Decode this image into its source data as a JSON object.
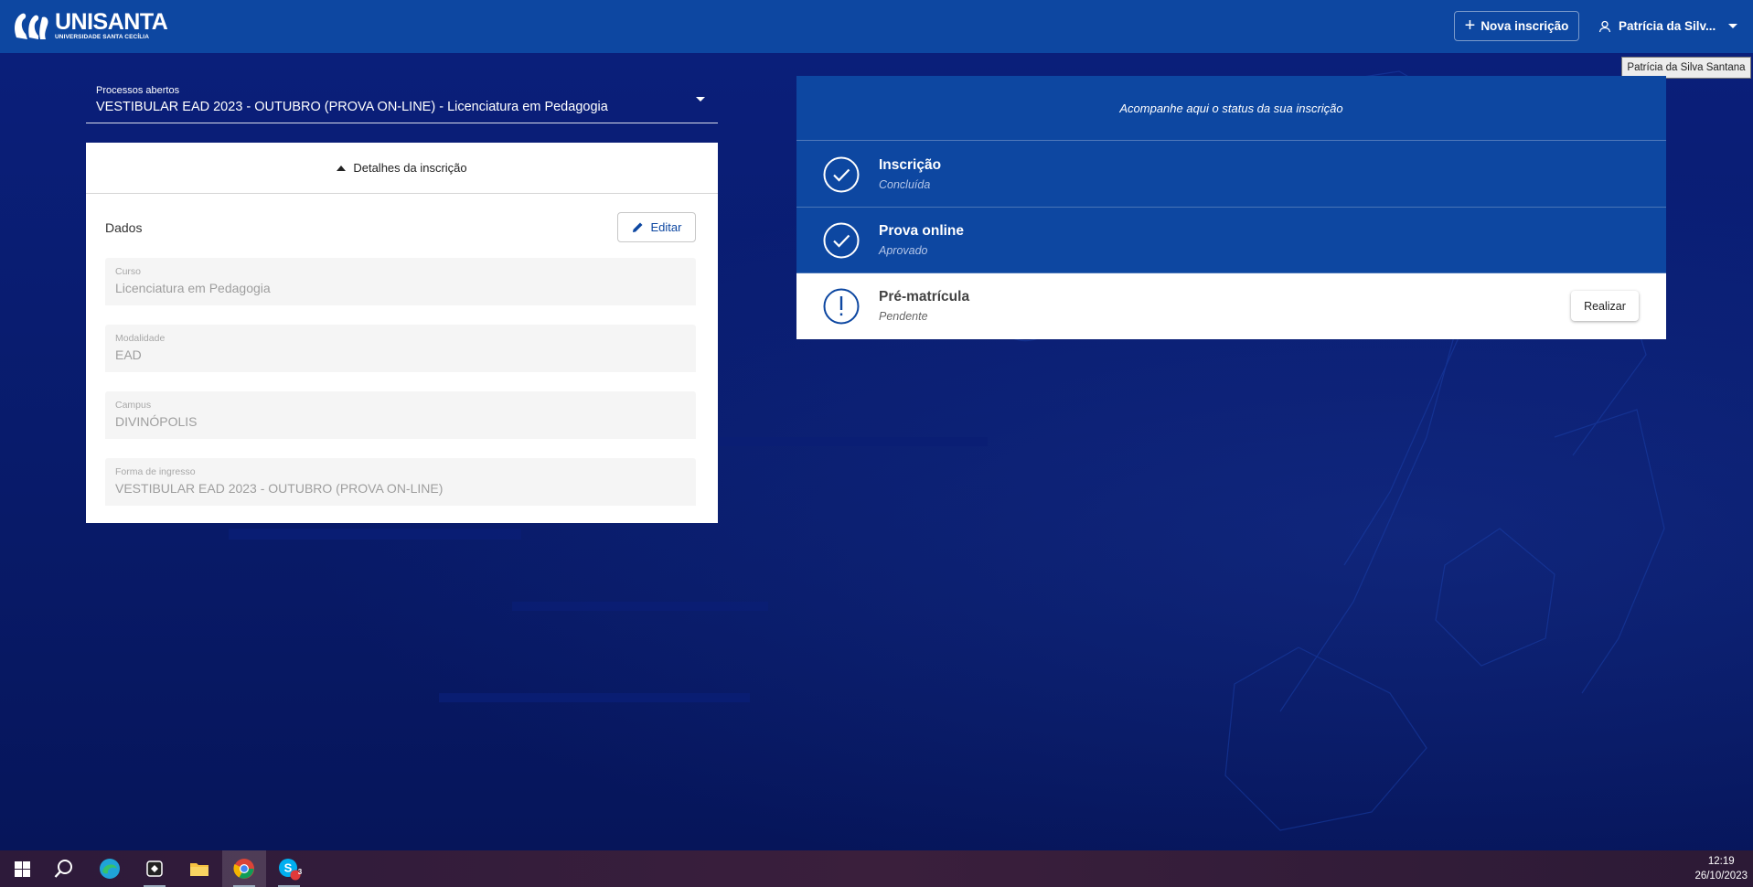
{
  "topbar": {
    "logo_name": "UNISANTA",
    "logo_sub": "UNIVERSIDADE SANTA CECÍLIA",
    "nova_label": "Nova inscrição",
    "user_label": "Patrícia da Silv...",
    "tooltip": "Patrícia da Silva Santana",
    "brand_color": "#0d47a1"
  },
  "processo": {
    "label": "Processos abertos",
    "value": "VESTIBULAR EAD 2023 - OUTUBRO (PROVA ON-LINE) - Licenciatura em Pedagogia"
  },
  "card": {
    "header": "Detalhes da inscrição",
    "section_title": "Dados",
    "edit_label": "Editar",
    "fields": [
      {
        "label": "Curso",
        "value": "Licenciatura em Pedagogia"
      },
      {
        "label": "Modalidade",
        "value": "EAD"
      },
      {
        "label": "Campus",
        "value": "DIVINÓPOLIS"
      },
      {
        "label": "Forma de ingresso",
        "value": "VESTIBULAR EAD 2023 - OUTUBRO (PROVA ON-LINE)"
      }
    ]
  },
  "status": {
    "header": "Acompanhe aqui o status da sua inscrição",
    "steps": [
      {
        "title": "Inscrição",
        "status": "Concluída",
        "icon": "check-circle-icon"
      },
      {
        "title": "Prova online",
        "status": "Aprovado",
        "icon": "check-circle-icon"
      },
      {
        "title": "Pré-matrícula",
        "status": "Pendente",
        "icon": "exclamation-circle-icon",
        "action": "Realizar"
      }
    ]
  },
  "taskbar": {
    "time": "12:19",
    "date": "26/10/2023",
    "skype_badge": "3",
    "icons": [
      "windows-start-icon",
      "search-icon",
      "edge-icon",
      "app-icon",
      "file-explorer-icon",
      "chrome-icon",
      "skype-icon"
    ]
  }
}
